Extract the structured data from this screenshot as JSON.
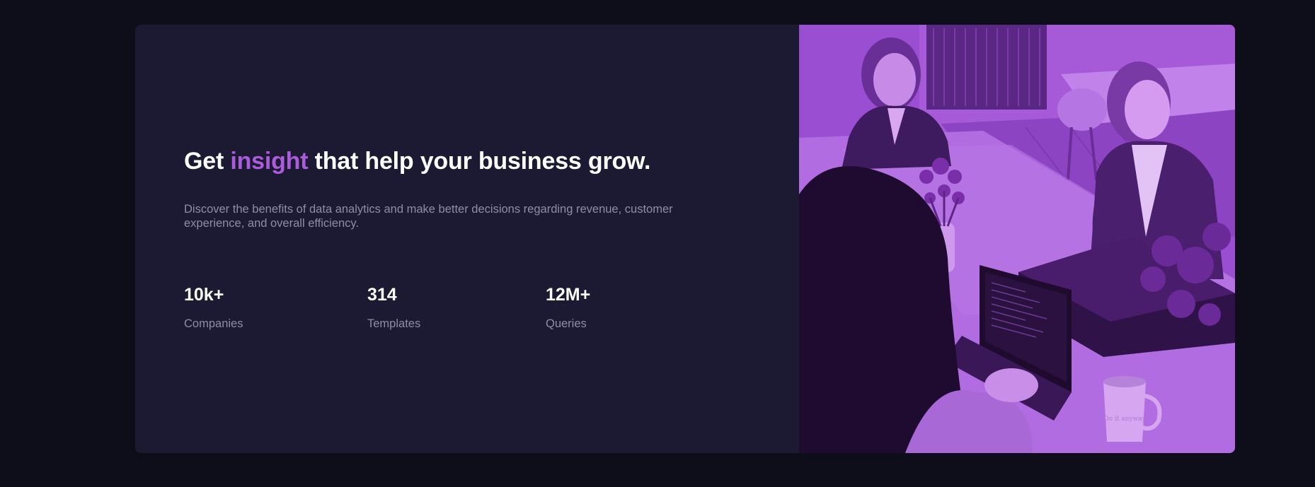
{
  "hero": {
    "headline_pre": "Get",
    "headline_accent": "insight",
    "headline_post": "that help your business grow.",
    "description": "Discover the benefits of data analytics and make better decisions regarding revenue, customer experience, and overall efficiency."
  },
  "stats": [
    {
      "value": "10k+",
      "label": "Companies"
    },
    {
      "value": "314",
      "label": "Templates"
    },
    {
      "value": "12M+",
      "label": "Queries"
    }
  ],
  "colors": {
    "page_background": "#0e0e1b",
    "card_background": "#1c1a32",
    "accent": "#aa5cdb",
    "muted_text": "#8f8ca6",
    "image_tint": "#8a3fc0"
  },
  "image": {
    "mug_text": "Do it anyway"
  }
}
